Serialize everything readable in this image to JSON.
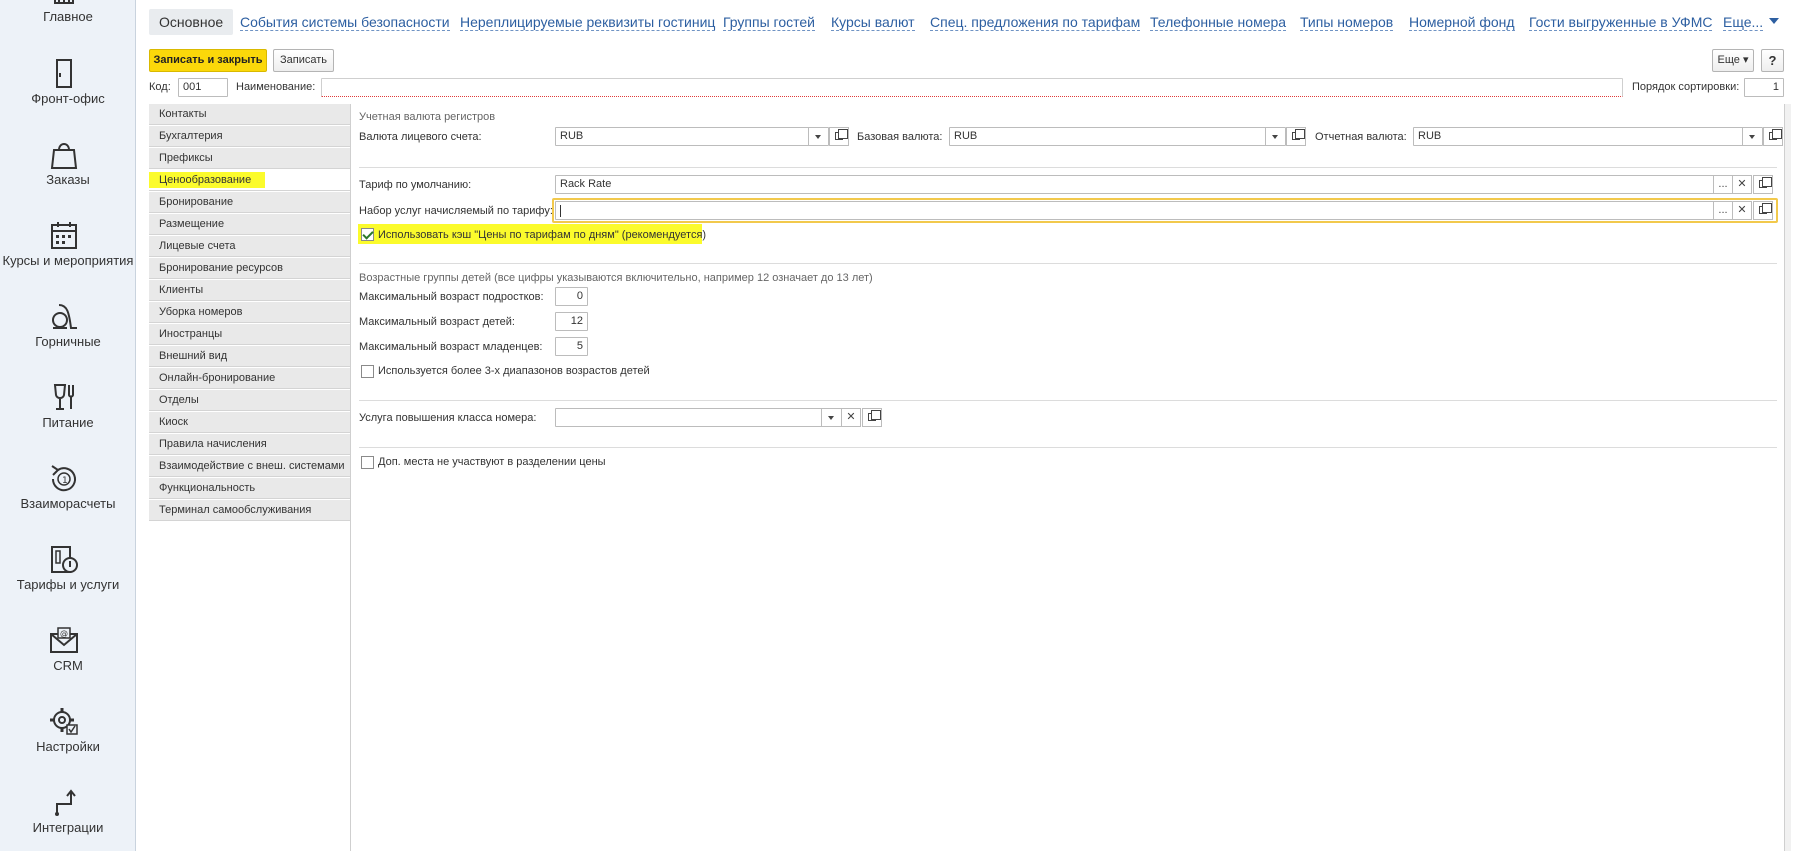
{
  "nav": {
    "items": [
      {
        "label": "Главное",
        "icon": "home-icon"
      },
      {
        "label": "Фронт-офис",
        "icon": "door-icon"
      },
      {
        "label": "Заказы",
        "icon": "bag-icon"
      },
      {
        "label": "Курсы и мероприятия",
        "icon": "calendar-icon"
      },
      {
        "label": "Горничные",
        "icon": "vacuum-icon"
      },
      {
        "label": "Питание",
        "icon": "glass-icon"
      },
      {
        "label": "Взаиморасчеты",
        "icon": "cycle-icon"
      },
      {
        "label": "Тарифы и услуги",
        "icon": "tariff-icon"
      },
      {
        "label": "CRM",
        "icon": "mail-icon"
      },
      {
        "label": "Настройки",
        "icon": "gear-icon"
      },
      {
        "label": "Интеграции",
        "icon": "integration-icon"
      }
    ]
  },
  "tabs": [
    "Основное",
    "События системы безопасности",
    "Нереплицируемые реквизиты гостиниц",
    "Группы гостей",
    "Курсы валют",
    "Спец. предложения по тарифам",
    "Телефонные номера",
    "Типы номеров",
    "Номерной фонд",
    "Гости выгруженные в УФМС",
    "Еще..."
  ],
  "toolbar": {
    "save_close": "Записать и закрыть",
    "save": "Записать",
    "more": "Еще",
    "help": "?"
  },
  "header": {
    "code_label": "Код:",
    "code_value": "001",
    "name_label": "Наименование:",
    "name_value": "",
    "sort_label": "Порядок сортировки:",
    "sort_value": "1"
  },
  "sections": [
    "Контакты",
    "Бухгалтерия",
    "Префиксы",
    "Ценообразование",
    "Бронирование",
    "Размещение",
    "Лицевые счета",
    "Бронирование ресурсов",
    "Клиенты",
    "Уборка номеров",
    "Иностранцы",
    "Внешний вид",
    "Онлайн-бронирование",
    "Отделы",
    "Киоск",
    "Правила начисления",
    "Взаимодействие с внеш. системами",
    "Функциональность",
    "Терминал самообслуживания"
  ],
  "pricing": {
    "currency_group_title": "Учетная валюта регистров",
    "folio_currency_label": "Валюта лицевого счета:",
    "folio_currency_value": "RUB",
    "base_currency_label": "Базовая валюта:",
    "base_currency_value": "RUB",
    "report_currency_label": "Отчетная валюта:",
    "report_currency_value": "RUB",
    "default_rate_label": "Тариф по умолчанию:",
    "default_rate_value": "Rack Rate",
    "service_set_label": "Набор услуг начисляемый по тарифу:",
    "service_set_value": "",
    "cache_checkbox_label": "Использовать кэш \"Цены по тарифам по дням\" (рекомендуется)",
    "cache_checked": true,
    "age_group_title": "Возрастные группы детей (все цифры указываются включительно, например 12 означает до 13 лет)",
    "teen_age_label": "Максимальный возраст подростков:",
    "teen_age_value": "0",
    "child_age_label": "Максимальный возраст детей:",
    "child_age_value": "12",
    "infant_age_label": "Максимальный возраст младенцев:",
    "infant_age_value": "5",
    "ranges_checkbox_label": "Используется более 3-х диапазонов возрастов детей",
    "ranges_checked": false,
    "upgrade_label": "Услуга повышения класса номера:",
    "upgrade_value": "",
    "extra_beds_label": "Доп. места не участвуют в разделении цены",
    "extra_beds_checked": false
  },
  "colors": {
    "highlight": "#fbfb2c",
    "primary_button": "#fbd80a",
    "link": "#2d5fa1"
  }
}
